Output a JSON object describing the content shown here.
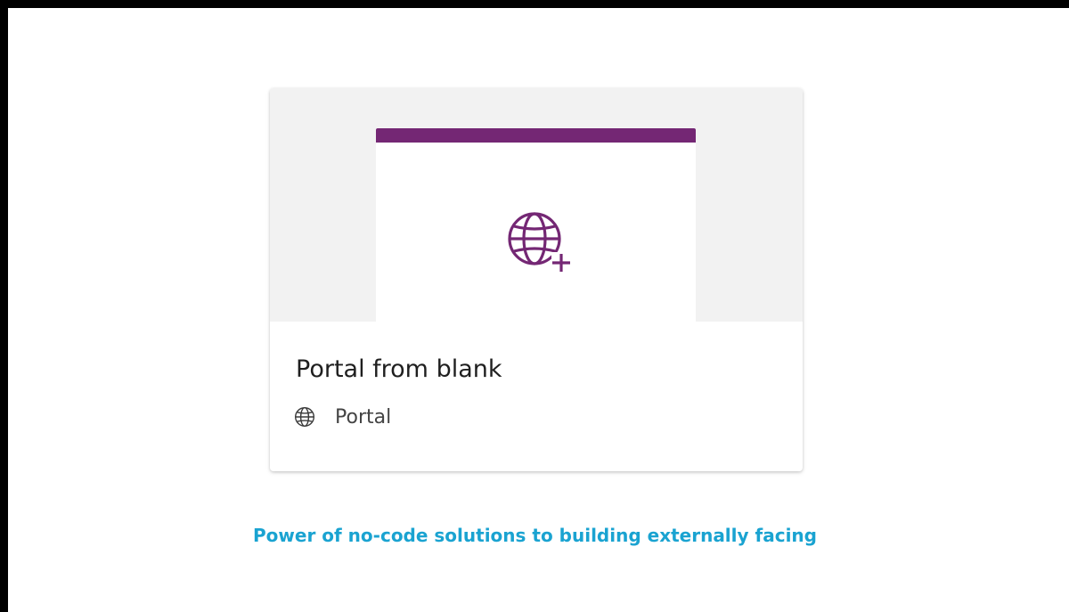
{
  "card": {
    "title": "Portal from blank",
    "type_label": "Portal",
    "hero_icon": "globe-add-icon",
    "type_icon": "globe-icon"
  },
  "caption": {
    "text": "Power of no-code solutions to building externally facing"
  },
  "colors": {
    "accent": "#742774",
    "caption": "#1aa3d1",
    "preview_bg": "#f2f2f2",
    "frame_border": "#000000"
  }
}
